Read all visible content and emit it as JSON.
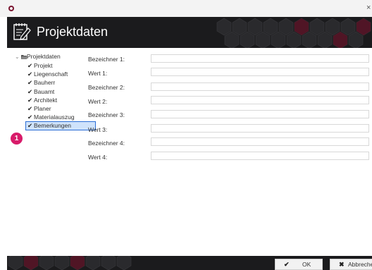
{
  "window": {
    "close_glyph": "×"
  },
  "header": {
    "title": "Projektdaten",
    "icon": "notepad-icon"
  },
  "tree": {
    "root_label": "Projektdaten",
    "items": [
      {
        "label": "Projekt"
      },
      {
        "label": "Liegenschaft"
      },
      {
        "label": "Bauherr"
      },
      {
        "label": "Bauamt"
      },
      {
        "label": "Architekt"
      },
      {
        "label": "Planer"
      },
      {
        "label": "Materialauszug"
      },
      {
        "label": "Bemerkungen"
      }
    ],
    "selected": "Bemerkungen"
  },
  "callout": {
    "number": "1",
    "color": "#d81b6a"
  },
  "form": {
    "fields": [
      {
        "label": "Bezeichner 1:",
        "value": ""
      },
      {
        "label": "Wert 1:",
        "value": ""
      },
      {
        "label": "Bezeichner 2:",
        "value": ""
      },
      {
        "label": "Wert 2:",
        "value": ""
      },
      {
        "label": "Bezeichner 3:",
        "value": ""
      },
      {
        "label": "Wert 3:",
        "value": ""
      },
      {
        "label": "Bezeichner 4:",
        "value": ""
      },
      {
        "label": "Wert 4:",
        "value": ""
      }
    ]
  },
  "footer": {
    "ok_label": "OK",
    "cancel_label": "Abbrechen"
  },
  "colors": {
    "header_bg": "#1b1b1d",
    "accent": "#d81b6a",
    "selection": "#2b6ed6"
  }
}
